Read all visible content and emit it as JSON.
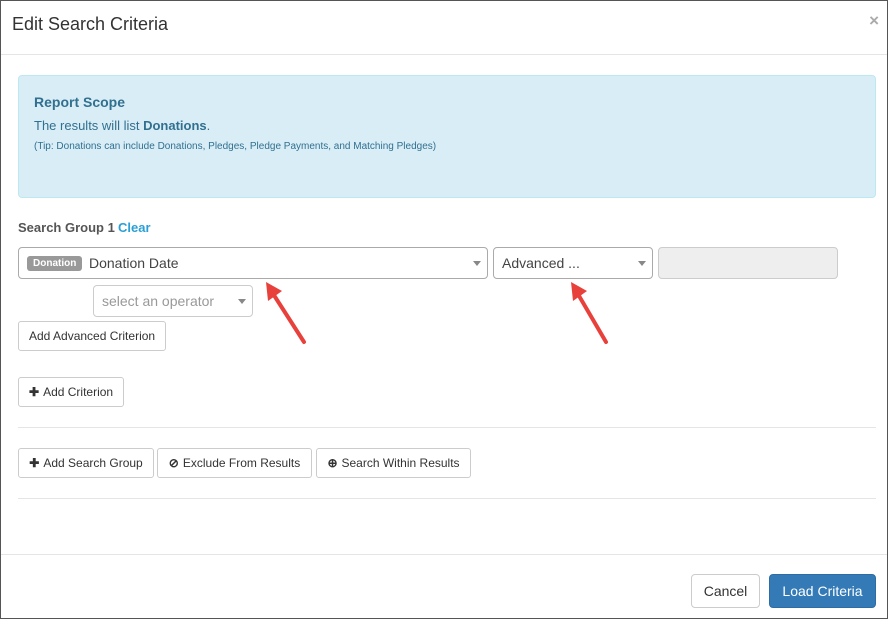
{
  "modal": {
    "title": "Edit Search Criteria",
    "close_icon": "close-icon"
  },
  "scope": {
    "title": "Report Scope",
    "line_prefix": "The results will list ",
    "line_bold": "Donations",
    "line_suffix": ".",
    "tip": "(Tip: Donations can include Donations, Pledges, Pledge Payments, and Matching Pledges)"
  },
  "search_group": {
    "label": "Search Group 1",
    "clear_label": "Clear",
    "criterion": {
      "badge": "Donation",
      "field_value": "Donation Date",
      "advanced_value": "Advanced ...",
      "operator_placeholder": "select an operator"
    },
    "add_advanced_label": "Add Advanced Criterion",
    "add_criterion_label": "Add Criterion"
  },
  "actions": {
    "add_group_label": "Add Search Group",
    "exclude_label": "Exclude From Results",
    "within_label": "Search Within Results"
  },
  "footer": {
    "cancel_label": "Cancel",
    "load_label": "Load Criteria"
  },
  "colors": {
    "accent": "#337ab7",
    "info_bg": "#d9edf7",
    "annotation_arrow": "#e8413c"
  }
}
